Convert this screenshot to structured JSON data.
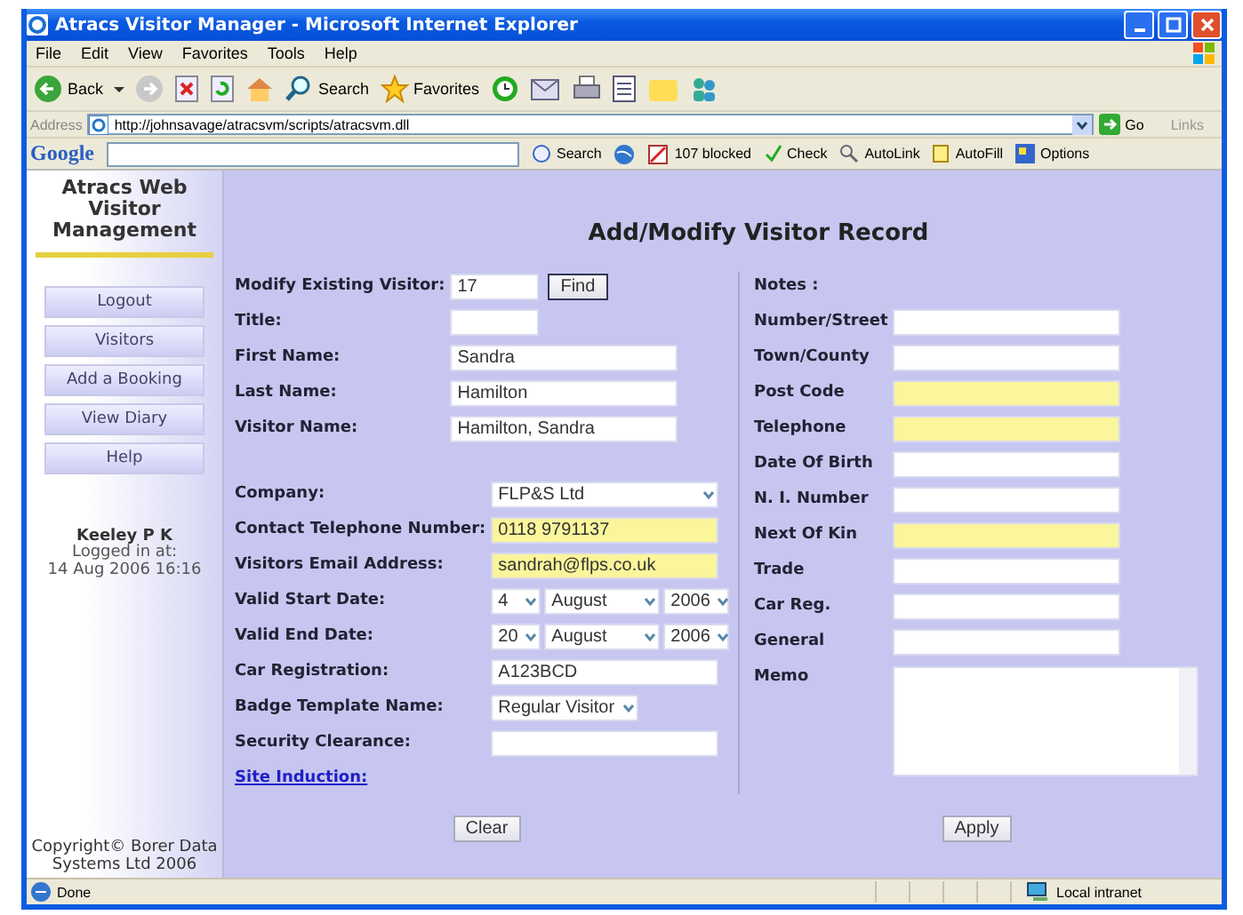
{
  "window": {
    "title": "Atracs Visitor Manager - Microsoft Internet Explorer"
  },
  "menu": [
    "File",
    "Edit",
    "View",
    "Favorites",
    "Tools",
    "Help"
  ],
  "toolbar": {
    "back": "Back",
    "search": "Search",
    "favorites": "Favorites"
  },
  "address": {
    "label": "Address",
    "url": "http://johnsavage/atracsvm/scripts/atracsvm.dll",
    "go": "Go",
    "links": "Links"
  },
  "google_bar": {
    "logo": "Google",
    "search": "Search",
    "blocked": "107 blocked",
    "check": "Check",
    "autolink": "AutoLink",
    "autofill": "AutoFill",
    "options": "Options"
  },
  "sidebar": {
    "title": "Atracs Web Visitor Management",
    "nav": [
      "Logout",
      "Visitors",
      "Add a Booking",
      "View Diary",
      "Help"
    ],
    "user": {
      "name": "Keeley P K",
      "logged_label": "Logged in at:",
      "time": "14 Aug 2006 16:16"
    },
    "copyright": "Copyright© Borer Data Systems Ltd 2006"
  },
  "form": {
    "title": "Add/Modify Visitor Record",
    "left": [
      {
        "fields": [
          {
            "label": "Modify Existing Visitor:",
            "kind": "short",
            "value": "17",
            "required": false,
            "button": "Find"
          },
          {
            "label": "Title:",
            "kind": "short",
            "required": false
          },
          {
            "label": "First Name:",
            "kind": "text",
            "value": "Sandra",
            "required": false
          },
          {
            "label": "Last Name:",
            "kind": "text",
            "value": "Hamilton",
            "required": false
          },
          {
            "label": "Visitor Name:",
            "kind": "text",
            "value": "Hamilton, Sandra",
            "required": false
          }
        ]
      },
      {
        "fields": [
          {
            "label": "Company:",
            "kind": "select",
            "value": "FLP&S Ltd"
          },
          {
            "label": "Contact Telephone Number:",
            "kind": "text",
            "value": "0118 9791137",
            "required": true
          },
          {
            "label": "Visitors Email Address:",
            "kind": "text",
            "value": "sandrah@flps.co.uk",
            "required": true
          },
          {
            "label": "Valid Start Date:",
            "kind": "date",
            "day": "4",
            "month": "August",
            "year": "2006"
          },
          {
            "label": "Valid End Date:",
            "kind": "date",
            "day": "20",
            "month": "August",
            "year": "2006"
          },
          {
            "label": "Car Registration:",
            "kind": "text",
            "value": "A123BCD",
            "required": false
          },
          {
            "label": "Badge Template Name:",
            "kind": "small_select",
            "value": "Regular Visitor"
          },
          {
            "label": "Security Clearance:",
            "kind": "text",
            "required": false
          },
          {
            "label": "Site Induction:",
            "kind": "link"
          }
        ]
      }
    ],
    "right": [
      {
        "label": "Notes :",
        "kind": "heading"
      },
      {
        "label": "Number/Street",
        "kind": "text",
        "required": false
      },
      {
        "label": "Town/County",
        "kind": "text",
        "required": false
      },
      {
        "label": "Post Code",
        "kind": "text",
        "required": true
      },
      {
        "label": "Telephone",
        "kind": "text",
        "required": true
      },
      {
        "label": "Date Of Birth",
        "kind": "text",
        "required": false
      },
      {
        "label": "N. I. Number",
        "kind": "text",
        "required": false
      },
      {
        "label": "Next Of Kin",
        "kind": "text",
        "required": true
      },
      {
        "label": "Trade",
        "kind": "text",
        "required": false
      },
      {
        "label": "Car Reg.",
        "kind": "text",
        "required": false
      },
      {
        "label": "General",
        "kind": "text",
        "required": false
      },
      {
        "label": "Memo",
        "kind": "memo"
      }
    ],
    "buttons": {
      "clear": "Clear",
      "apply": "Apply"
    }
  },
  "status_bar": {
    "text": "Done",
    "zone": "Local intranet"
  }
}
